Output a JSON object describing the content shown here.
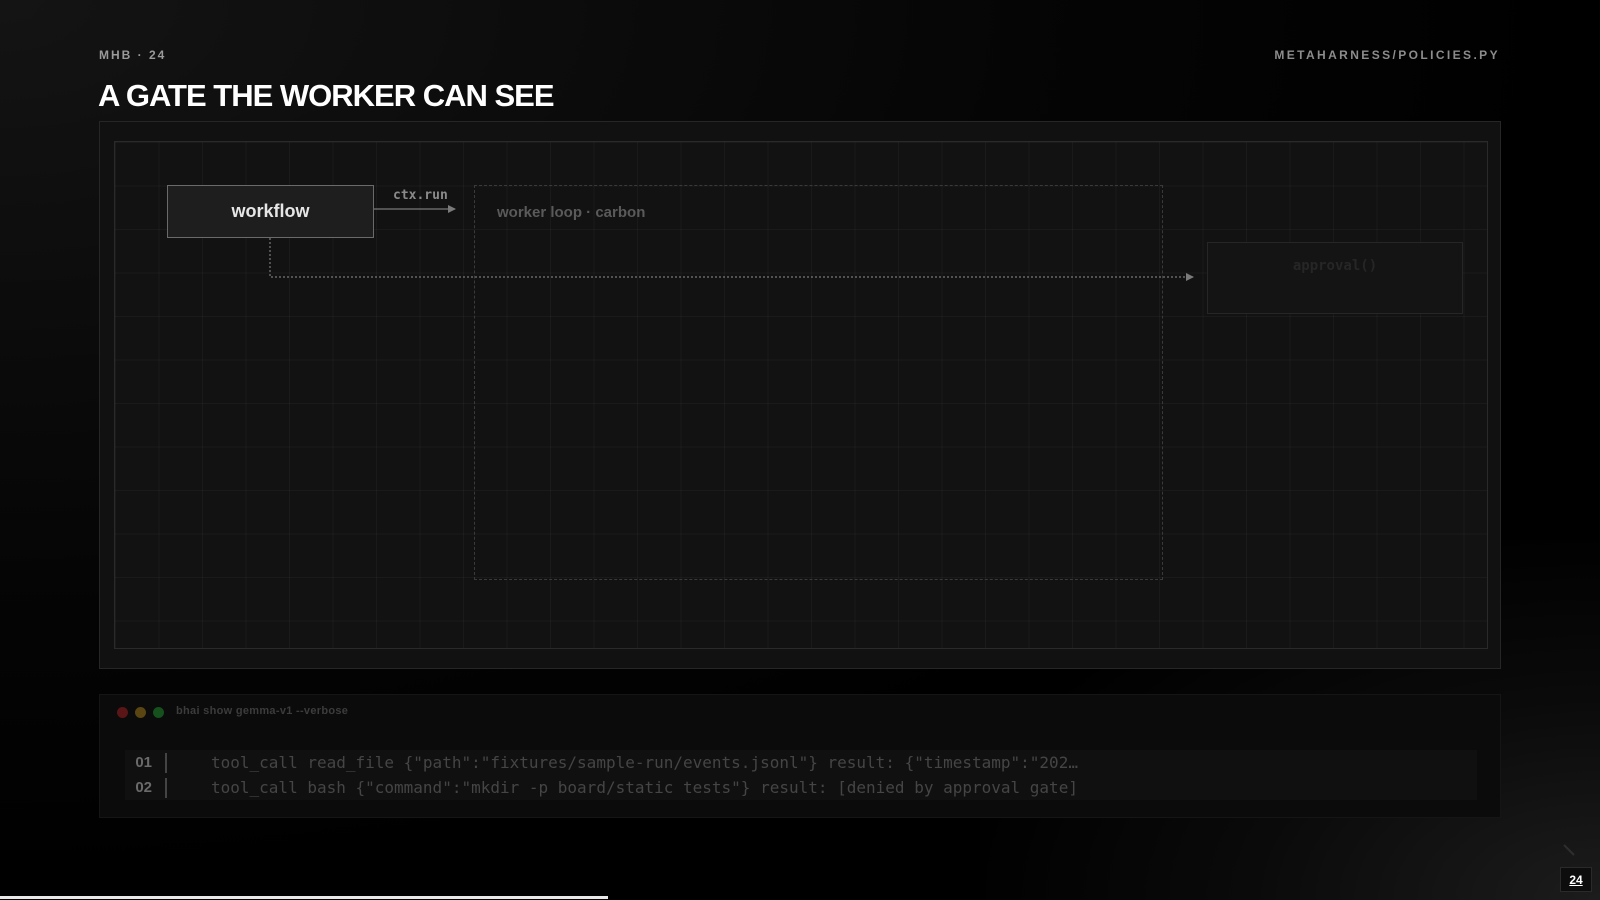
{
  "header": {
    "kicker": "MHB · 24",
    "source_path": "METAHARNESS/POLICIES.PY",
    "title": "A GATE THE WORKER CAN SEE"
  },
  "diagram": {
    "workflow_label": "workflow",
    "edge_label": "ctx.run",
    "loop_label": "worker loop · carbon",
    "approval_label": "approval()"
  },
  "terminal": {
    "command": "bhai show gemma-v1 --verbose",
    "lines": [
      {
        "num": "01",
        "text": "tool_call read_file {\"path\":\"fixtures/sample-run/events.jsonl\"} result: {\"timestamp\":\"202…"
      },
      {
        "num": "02",
        "text": "tool_call bash {\"command\":\"mkdir -p board/static tests\"} result: [denied by approval gate]"
      }
    ]
  },
  "footer": {
    "page_number": "24",
    "progress_fraction": 0.38
  },
  "colors": {
    "accent": "#ffffff",
    "dot_red": "#5a1616",
    "dot_yellow": "#5a4513",
    "dot_green": "#15501d"
  },
  "icons": {
    "next": "chevron-right-icon"
  }
}
